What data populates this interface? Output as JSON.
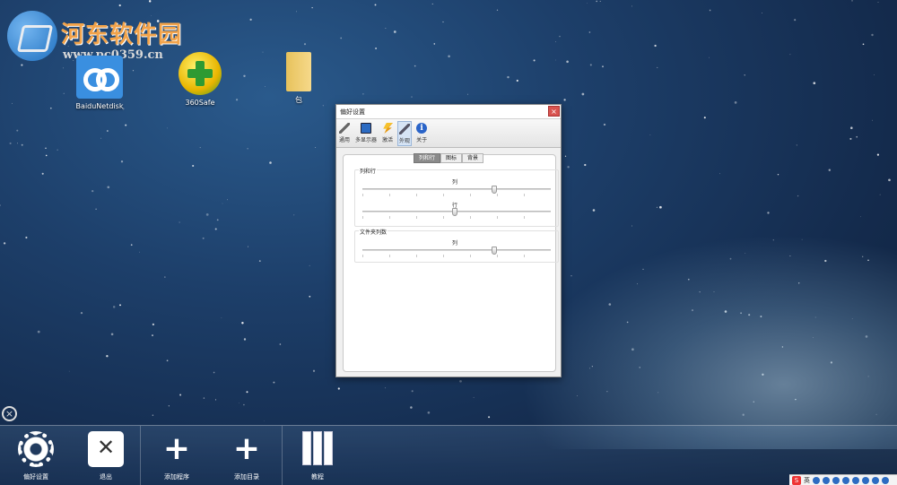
{
  "watermark": {
    "brand": "河东软件园",
    "url": "www.pc0359.cn"
  },
  "desktop_icons": [
    {
      "label": "BaiduNetdisk",
      "icon": "baidu-netdisk-icon"
    },
    {
      "label": "360Safe",
      "icon": "360-safe-icon"
    },
    {
      "label": "包",
      "icon": "folder-icon"
    }
  ],
  "window": {
    "title": "偏好设置",
    "close_glyph": "×",
    "toolbar": [
      {
        "label": "通用",
        "icon": "wrench-icon",
        "active": false
      },
      {
        "label": "多显示器",
        "icon": "monitor-icon",
        "active": false
      },
      {
        "label": "激活",
        "icon": "bolt-icon",
        "active": false
      },
      {
        "label": "外观",
        "icon": "appearance-icon",
        "active": true
      },
      {
        "label": "关于",
        "icon": "info-icon",
        "active": false
      }
    ],
    "tabs": [
      {
        "label": "列和行",
        "active": true
      },
      {
        "label": "图标",
        "active": false
      },
      {
        "label": "背景",
        "active": false
      }
    ],
    "groups": [
      {
        "title": "列和行",
        "sliders": [
          {
            "label": "列",
            "value_fraction": 0.7
          },
          {
            "label": "行",
            "value_fraction": 0.49
          }
        ]
      },
      {
        "title": "文件夹列数",
        "sliders": [
          {
            "label": "列",
            "value_fraction": 0.7
          }
        ]
      }
    ]
  },
  "dock": {
    "close_glyph": "×",
    "items": [
      {
        "label": "偏好设置",
        "icon": "gear-icon"
      },
      {
        "label": "退出",
        "icon": "exit-icon",
        "glyph": "✕"
      },
      {
        "label": "添加程序",
        "icon": "add-program-icon",
        "glyph": "+"
      },
      {
        "label": "添加目录",
        "icon": "add-folder-icon",
        "glyph": "+"
      },
      {
        "label": "教程",
        "icon": "books-icon"
      }
    ]
  },
  "tray": {
    "ime_logo": "S",
    "ime_mode": "英"
  },
  "colors": {
    "accent_close": "#d9534f",
    "active_tab": "#8a8a8a",
    "sky": "#1d3f6a"
  }
}
